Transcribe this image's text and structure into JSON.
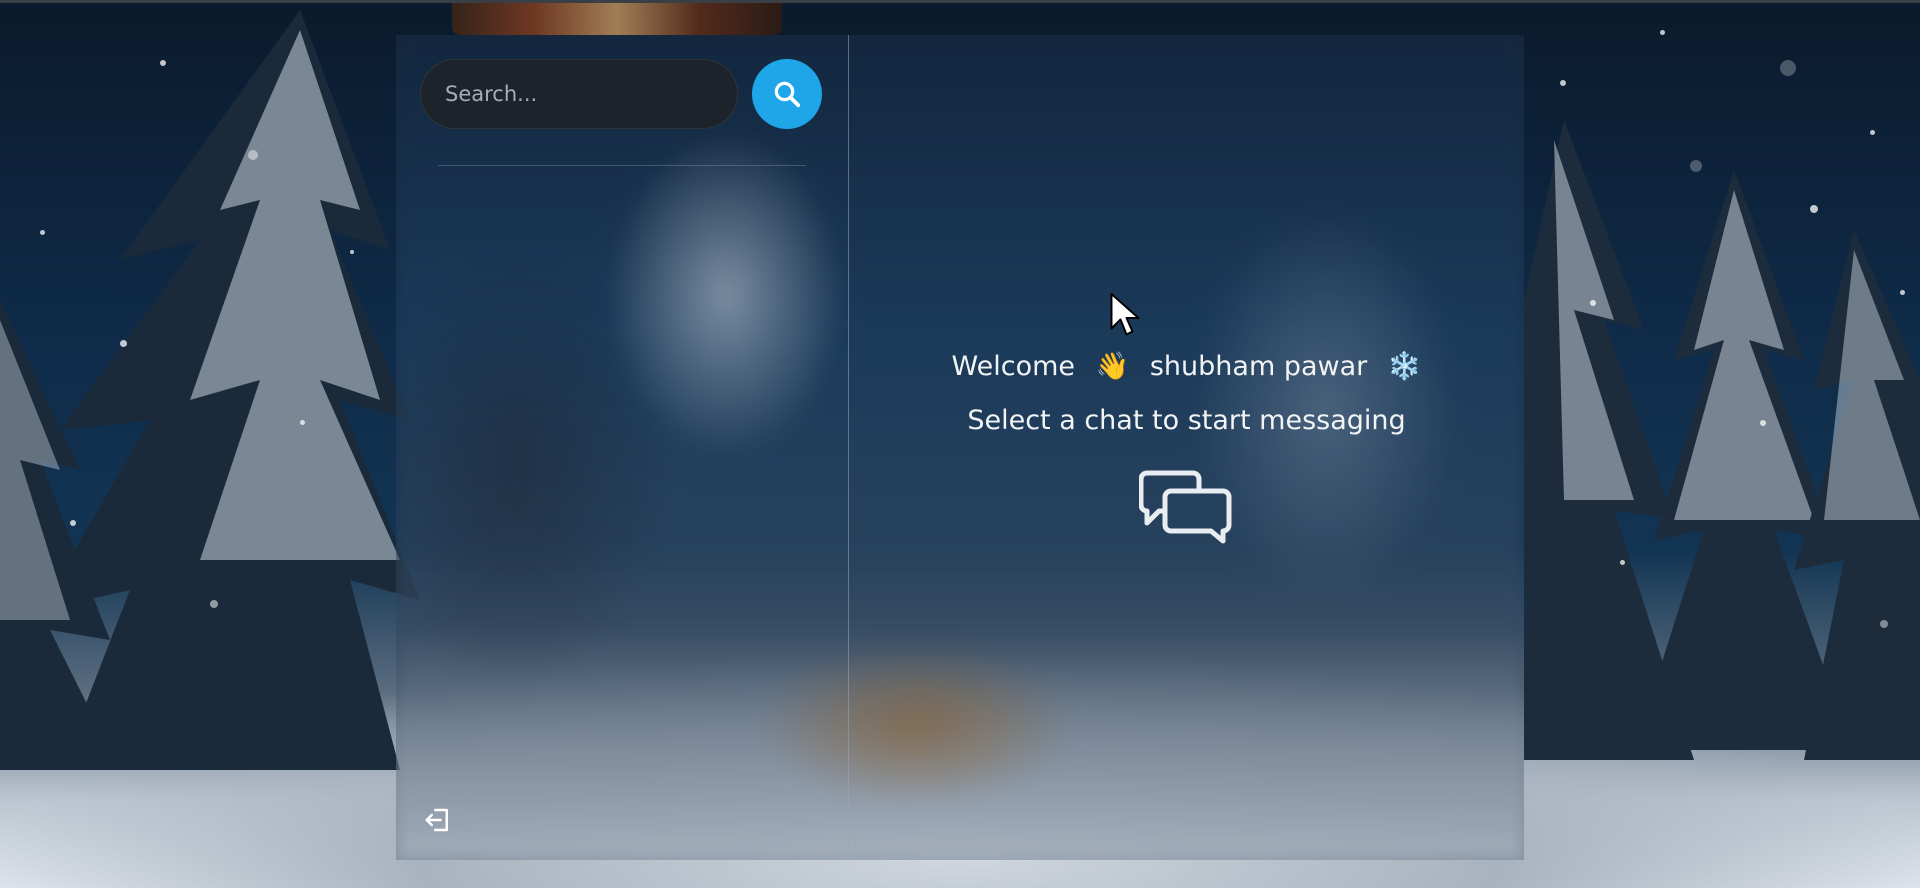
{
  "search": {
    "placeholder": "Search...",
    "button_icon": "search-icon"
  },
  "sidebar": {
    "logout_icon": "logout-icon"
  },
  "welcome": {
    "greeting": "Welcome",
    "wave_emoji": "👋",
    "username": "shubham pawar",
    "snow_emoji": "❄️"
  },
  "empty_state": {
    "message": "Select a chat to start messaging",
    "icon": "chat-bubbles-icon"
  },
  "colors": {
    "accent": "#1ea6e8",
    "search_bg": "#1d232b",
    "text": "#f1f3f5"
  }
}
